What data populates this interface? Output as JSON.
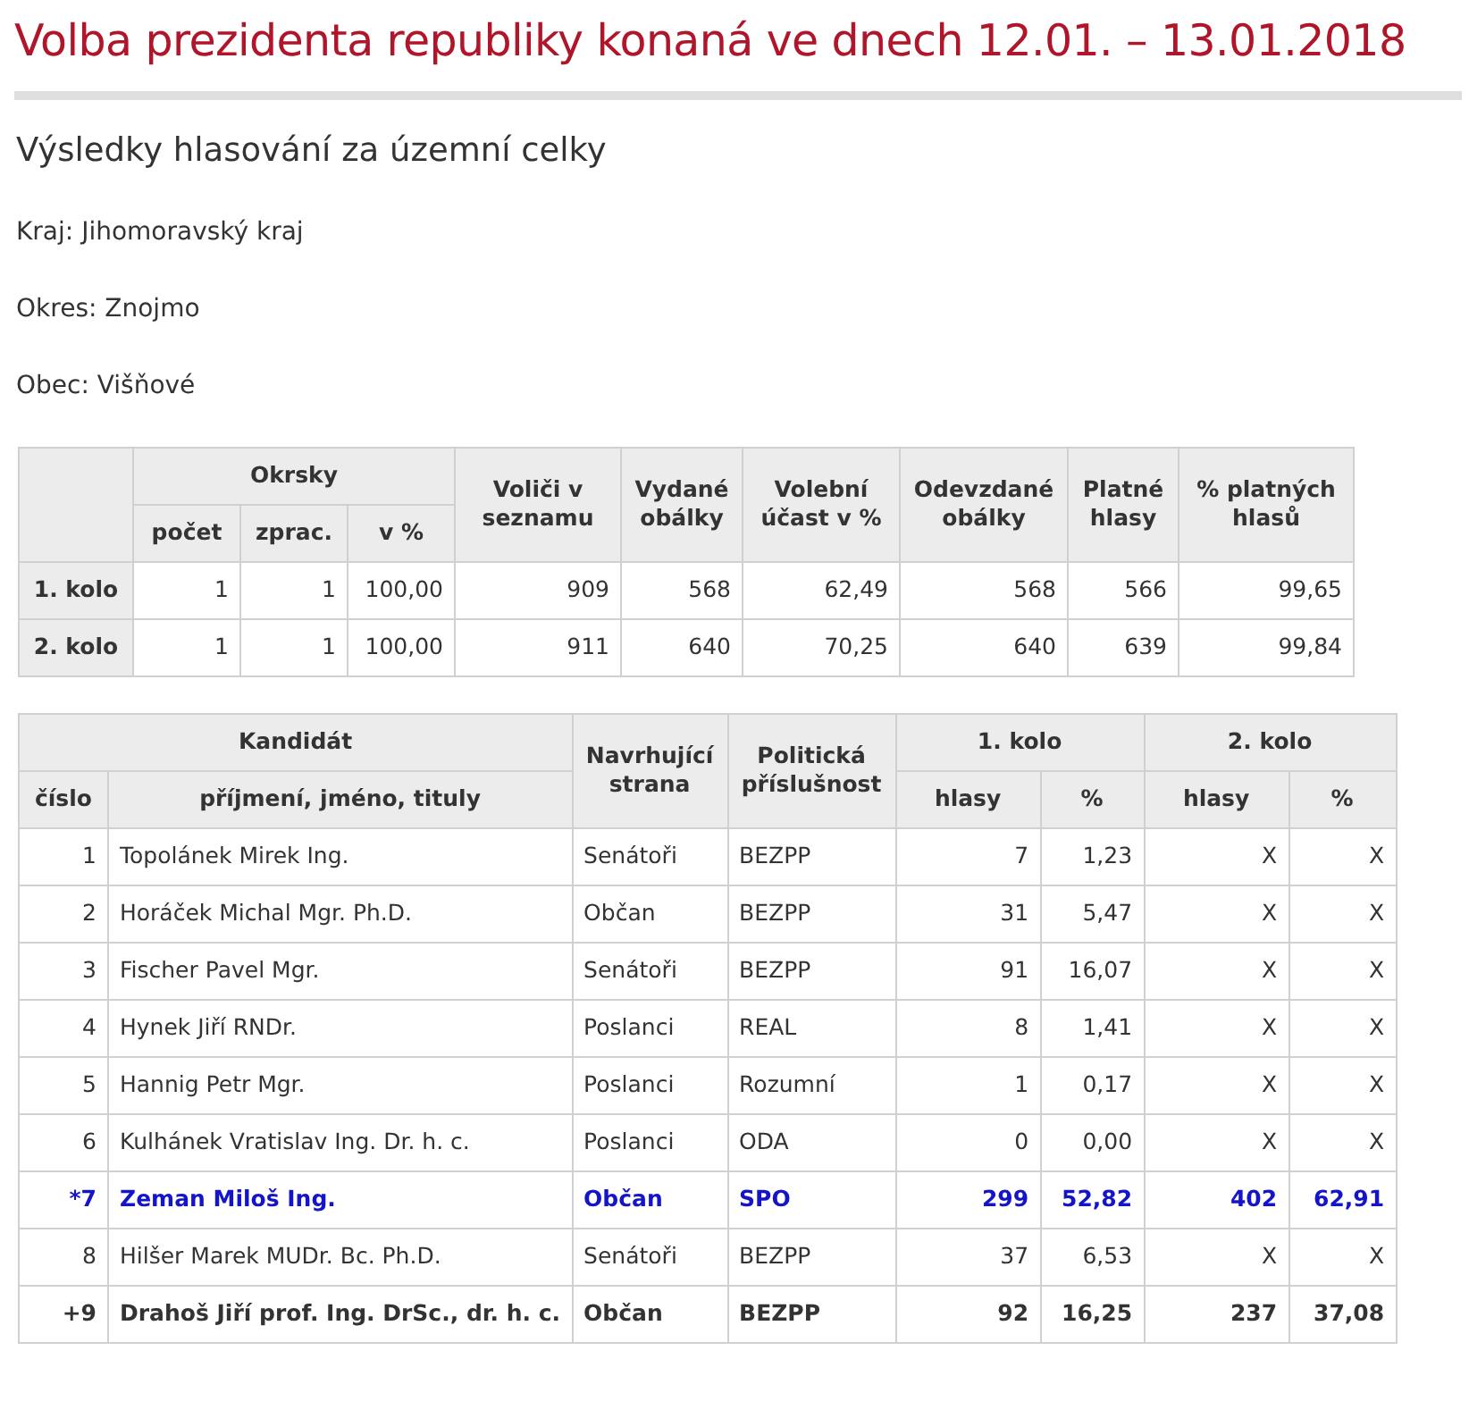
{
  "title": "Volba prezidenta republiky konaná ve dnech 12.01. – 13.01.2018",
  "subtitle": "Výsledky hlasování za územní celky",
  "info": [
    "Kraj: Jihomoravský kraj",
    "Okres: Znojmo",
    "Obec: Višňové"
  ],
  "turnout_table": {
    "group_header": "Okrsky",
    "columns": [
      "",
      "počet",
      "zprac.",
      "v %",
      "Voliči v seznamu",
      "Vydané obálky",
      "Volební účast v %",
      "Odevzdané obálky",
      "Platné hlasy",
      "% platných hlasů"
    ],
    "rows": [
      {
        "cells": [
          "1. kolo",
          "1",
          "1",
          "100,00",
          "909",
          "568",
          "62,49",
          "568",
          "566",
          "99,65"
        ]
      },
      {
        "cells": [
          "2. kolo",
          "1",
          "1",
          "100,00",
          "911",
          "640",
          "70,25",
          "640",
          "639",
          "99,84"
        ]
      }
    ]
  },
  "candidates_table": {
    "candidate_header": "Kandidát",
    "candidate_sub": [
      "číslo",
      "příjmení, jméno, tituly"
    ],
    "party_header": "Navrhující strana",
    "affiliation_header": "Politická příslušnost",
    "rounds": [
      {
        "label": "1. kolo",
        "sub": [
          "hlasy",
          "%"
        ]
      },
      {
        "label": "2. kolo",
        "sub": [
          "hlasy",
          "%"
        ]
      }
    ],
    "rows": [
      {
        "kind": "normal",
        "number": "1",
        "name": "Topolánek Mirek Ing.",
        "party": "Senátoři",
        "affiliation": "BEZPP",
        "votes": [
          "7",
          "1,23",
          "X",
          "X"
        ]
      },
      {
        "kind": "normal",
        "number": "2",
        "name": "Horáček Michal Mgr. Ph.D.",
        "party": "Občan",
        "affiliation": "BEZPP",
        "votes": [
          "31",
          "5,47",
          "X",
          "X"
        ]
      },
      {
        "kind": "normal",
        "number": "3",
        "name": "Fischer Pavel Mgr.",
        "party": "Senátoři",
        "affiliation": "BEZPP",
        "votes": [
          "91",
          "16,07",
          "X",
          "X"
        ]
      },
      {
        "kind": "normal",
        "number": "4",
        "name": "Hynek Jiří RNDr.",
        "party": "Poslanci",
        "affiliation": "REAL",
        "votes": [
          "8",
          "1,41",
          "X",
          "X"
        ]
      },
      {
        "kind": "normal",
        "number": "5",
        "name": "Hannig Petr Mgr.",
        "party": "Poslanci",
        "affiliation": "Rozumní",
        "votes": [
          "1",
          "0,17",
          "X",
          "X"
        ]
      },
      {
        "kind": "normal",
        "number": "6",
        "name": "Kulhánek Vratislav Ing. Dr. h. c.",
        "party": "Poslanci",
        "affiliation": "ODA",
        "votes": [
          "0",
          "0,00",
          "X",
          "X"
        ]
      },
      {
        "kind": "elected",
        "number": "*7",
        "name": "Zeman Miloš Ing.",
        "party": "Občan",
        "affiliation": "SPO",
        "votes": [
          "299",
          "52,82",
          "402",
          "62,91"
        ]
      },
      {
        "kind": "normal",
        "number": "8",
        "name": "Hilšer Marek MUDr. Bc. Ph.D.",
        "party": "Senátoři",
        "affiliation": "BEZPP",
        "votes": [
          "37",
          "6,53",
          "X",
          "X"
        ]
      },
      {
        "kind": "advanced",
        "number": "+9",
        "name": "Drahoš Jiří prof. Ing. DrSc., dr. h. c.",
        "party": "Občan",
        "affiliation": "BEZPP",
        "votes": [
          "92",
          "16,25",
          "237",
          "37,08"
        ]
      }
    ]
  }
}
